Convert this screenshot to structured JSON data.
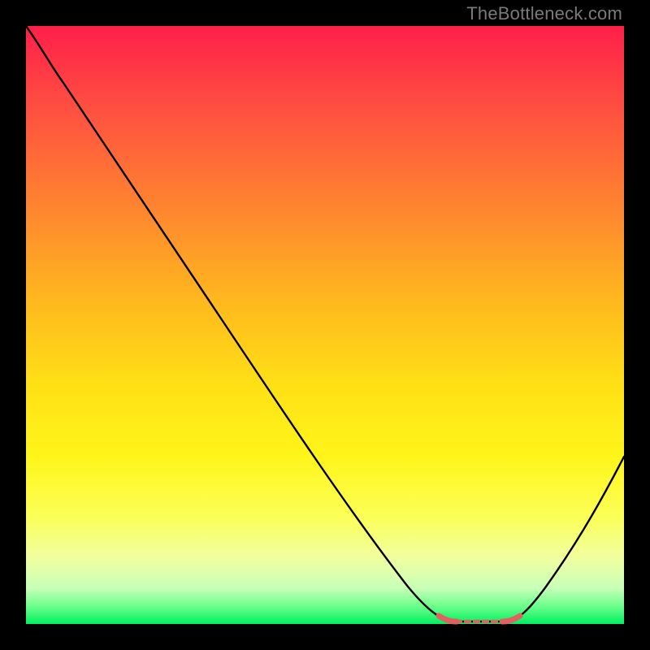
{
  "watermark": "TheBottleneck.com",
  "colors": {
    "background": "#000000",
    "gradient_top": "#ff1f4a",
    "gradient_bottom": "#00f060",
    "curve": "#000000",
    "highlight": "#e0615f"
  },
  "chart_data": {
    "type": "line",
    "title": "",
    "xlabel": "",
    "ylabel": "",
    "xlim": [
      0,
      100
    ],
    "ylim": [
      0,
      100
    ],
    "series": [
      {
        "name": "bottleneck-curve",
        "x": [
          0,
          4,
          8,
          12,
          16,
          20,
          24,
          28,
          32,
          36,
          40,
          44,
          48,
          52,
          56,
          60,
          63,
          66,
          69,
          72,
          75,
          78,
          80,
          83,
          86,
          89,
          92,
          95,
          98,
          100
        ],
        "values": [
          100,
          97,
          93,
          88,
          82,
          76,
          70,
          64,
          58,
          52,
          46,
          40,
          34,
          28,
          22,
          16,
          11,
          7,
          4,
          2,
          1,
          1,
          1,
          2,
          4,
          8,
          14,
          22,
          32,
          40
        ]
      }
    ],
    "annotations": [
      {
        "name": "valley-highlight",
        "x_range": [
          70,
          80
        ],
        "y": 1
      }
    ]
  }
}
